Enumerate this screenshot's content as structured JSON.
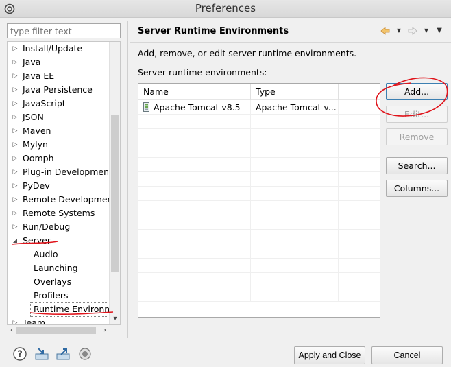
{
  "window": {
    "title": "Preferences"
  },
  "filter": {
    "placeholder": "type filter text"
  },
  "tree": {
    "items": [
      {
        "label": "Install/Update",
        "expanded": false
      },
      {
        "label": "Java",
        "expanded": false
      },
      {
        "label": "Java EE",
        "expanded": false
      },
      {
        "label": "Java Persistence",
        "expanded": false
      },
      {
        "label": "JavaScript",
        "expanded": false
      },
      {
        "label": "JSON",
        "expanded": false
      },
      {
        "label": "Maven",
        "expanded": false
      },
      {
        "label": "Mylyn",
        "expanded": false
      },
      {
        "label": "Oomph",
        "expanded": false
      },
      {
        "label": "Plug-in Development",
        "expanded": false
      },
      {
        "label": "PyDev",
        "expanded": false
      },
      {
        "label": "Remote Development",
        "expanded": false
      },
      {
        "label": "Remote Systems",
        "expanded": false
      },
      {
        "label": "Run/Debug",
        "expanded": false
      },
      {
        "label": "Server",
        "expanded": true
      },
      {
        "label": "Audio",
        "child": true
      },
      {
        "label": "Launching",
        "child": true
      },
      {
        "label": "Overlays",
        "child": true
      },
      {
        "label": "Profilers",
        "child": true
      },
      {
        "label": "Runtime Environme",
        "child": true,
        "selected": true
      },
      {
        "label": "Team",
        "expanded": false
      }
    ]
  },
  "page": {
    "title": "Server Runtime Environments",
    "description": "Add, remove, or edit server runtime environments.",
    "list_label": "Server runtime environments:"
  },
  "table": {
    "columns": [
      "Name",
      "Type"
    ],
    "rows": [
      {
        "name": "Apache Tomcat v8.5",
        "type": "Apache Tomcat v..."
      }
    ]
  },
  "buttons": {
    "add": "Add...",
    "edit": "Edit...",
    "remove": "Remove",
    "search": "Search...",
    "columns": "Columns..."
  },
  "footer": {
    "apply_close": "Apply and Close",
    "cancel": "Cancel"
  },
  "icons": {
    "app": "eclipse-icon",
    "back": "back-arrow-icon",
    "forward": "forward-arrow-icon",
    "menu": "view-menu-icon",
    "help": "help-icon",
    "import": "import-icon",
    "export": "export-icon",
    "record": "record-icon"
  },
  "colors": {
    "annotation_red": "#e0141b",
    "back_arrow": "#e6a33c",
    "accent": "#3c7fb1"
  }
}
